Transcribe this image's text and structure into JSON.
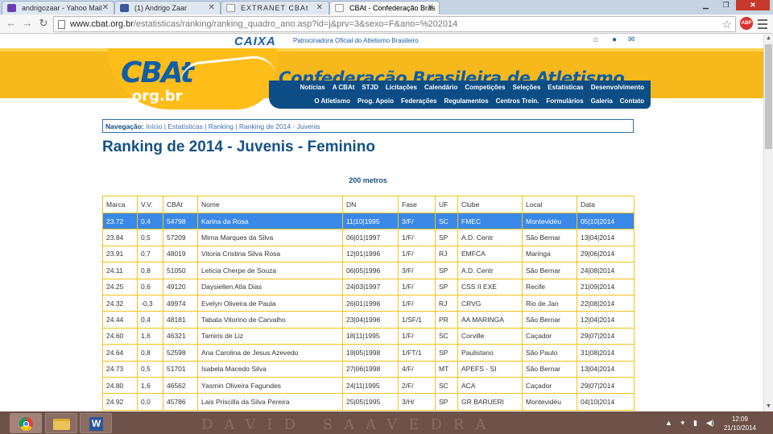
{
  "browser": {
    "tabs": [
      {
        "title": "andrigozaar - Yahoo Mail",
        "icon": "yahoo-mail-icon"
      },
      {
        "title": "(1) Andrigo Zaar",
        "icon": "facebook-icon"
      },
      {
        "title": "EXTRANET CBAt",
        "icon": "page-icon"
      },
      {
        "title": "CBAt - Confederação Bras",
        "icon": "page-icon"
      }
    ],
    "url_host": "www.cbat.org.br",
    "url_path": "/estatisticas/ranking/ranking_quadro_ano.asp?id=j&prv=3&sexo=F&ano=%202014",
    "abp_label": "ABP"
  },
  "site": {
    "sponsor_logo": "CAIXA",
    "sponsor_text": "Patrocinadora Oficial do Atletismo Brasileiro",
    "logo_letters": "CBAt",
    "logo_domain": ".org.br",
    "title": "Confederação Brasileira de Atletismo",
    "menu_row1": [
      "Notícias",
      "A CBAt",
      "STJD",
      "Licitações",
      "Calendário",
      "Competições",
      "Seleções",
      "Estatísticas",
      "Desenvolvimento"
    ],
    "menu_row2": [
      "O Atletismo",
      "Prog. Apoio",
      "Federações",
      "Regulamentos",
      "Centros Trein.",
      "Formulários",
      "Galeria",
      "Contato"
    ]
  },
  "breadcrumb": {
    "label": "Navegação:",
    "path": "Início | Estatísticas | Ranking | Ranking de 2014 - Juvenis"
  },
  "page_title": "Ranking de 2014 - Juvenis - Feminino",
  "event_name": "200 metros",
  "table": {
    "headers": [
      "Marca",
      "V.V.",
      "CBAt",
      "Nome",
      "DN",
      "Fase",
      "UF",
      "Clube",
      "Local",
      "Data"
    ],
    "rows": [
      [
        "23.72",
        "0,4",
        "54798",
        "Karina da Rosa",
        "11|10|1995",
        "3/F/",
        "SC",
        "FMEC",
        "Montevidéu",
        "05|10|2014"
      ],
      [
        "23.84",
        "0,5",
        "57209",
        "Mirna Marques da Silva",
        "06|01|1997",
        "1/F/",
        "SP",
        "A.D. Centr",
        "São Bernar",
        "13|04|2014"
      ],
      [
        "23.91",
        "0,7",
        "48019",
        "Vitoria Cristina Silva Rosa",
        "12|01|1996",
        "1/F/",
        "RJ",
        "EMFCA",
        "Maringa",
        "29|06|2014"
      ],
      [
        "24.11",
        "0,8",
        "51050",
        "Leticia Cherpe de Souza",
        "06|05|1996",
        "3/F/",
        "SP",
        "A.D. Centr",
        "São Bernar",
        "24|08|2014"
      ],
      [
        "24.25",
        "0,6",
        "49120",
        "Daysiellen Atla Dias",
        "24|03|1997",
        "1/F/",
        "SP",
        "CSS II EXE",
        "Recife",
        "21|09|2014"
      ],
      [
        "24.32",
        "-0,3",
        "49974",
        "Evelyn Oliveira de Paula",
        "26|01|1996",
        "1/F/",
        "RJ",
        "CRVG",
        "Rio de Jan",
        "22|08|2014"
      ],
      [
        "24.44",
        "0,4",
        "48181",
        "Tabata Vitorino de Carvalho",
        "23|04|1996",
        "1/SF/1",
        "PR",
        "AA MARINGA",
        "São Bernar",
        "12|04|2014"
      ],
      [
        "24.60",
        "1,6",
        "46321",
        "Tamiris de Liz",
        "18|11|1995",
        "1/F/",
        "SC",
        "Corville",
        "Caçador",
        "29|07|2014"
      ],
      [
        "24.64",
        "0,8",
        "52598",
        "Ana Carolina de Jesus Azevedo",
        "19|05|1998",
        "1/FT/1",
        "SP",
        "Paulistano",
        "São Paulo",
        "31|08|2014"
      ],
      [
        "24.73",
        "0,5",
        "51701",
        "Isabela Macedo Silva",
        "27|06|1998",
        "4/F/",
        "MT",
        "APEFS - SI",
        "São Bernar",
        "13|04|2014"
      ],
      [
        "24.80",
        "1,6",
        "46562",
        "Yasmin Oliveira Fagundes",
        "24|11|1995",
        "2/F/",
        "SC",
        "ACA",
        "Caçador",
        "29|07|2014"
      ],
      [
        "24.92",
        "0,0",
        "45786",
        "Lais Priscilla da Silva Pereira",
        "25|05|1995",
        "3/H/",
        "SP",
        "GR BARUERI",
        "Montevidéu",
        "04|10|2014"
      ]
    ]
  },
  "taskbar": {
    "watermark": "DAVID SAAVEDRA",
    "time": "12:09",
    "date": "21/10/2014"
  }
}
